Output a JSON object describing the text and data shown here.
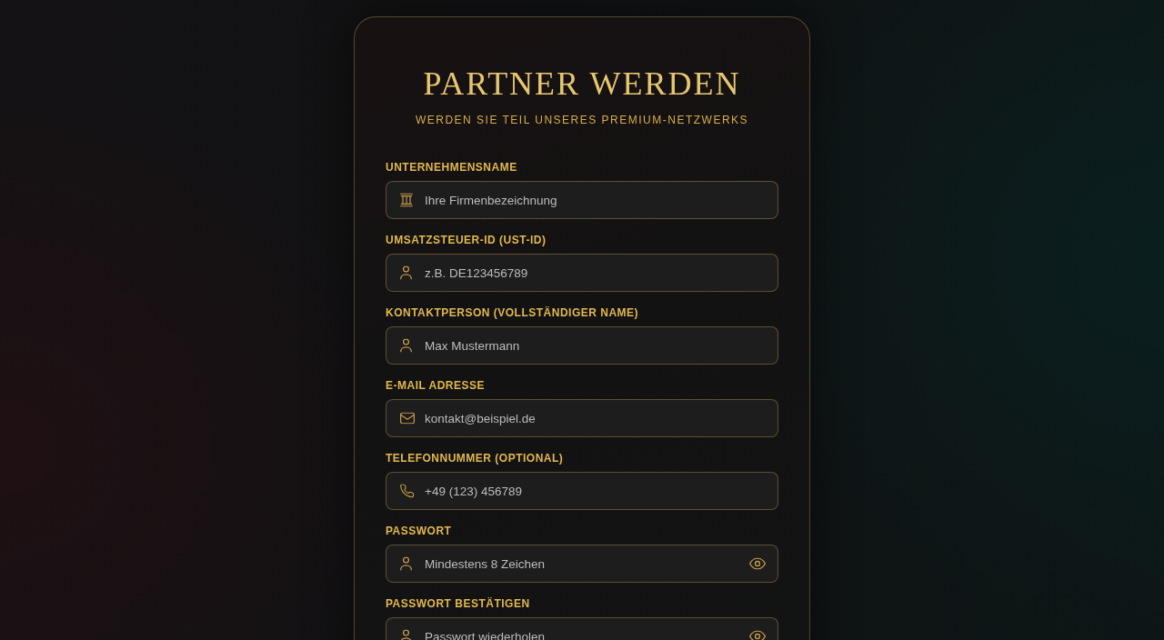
{
  "title": "PARTNER WERDEN",
  "subtitle": "WERDEN SIE TEIL UNSERES PREMIUM-NETZWERKS",
  "fields": [
    {
      "kind": "company",
      "label": "UNTERNEHMENSNAME",
      "placeholder": "Ihre Firmenbezeichnung"
    },
    {
      "kind": "text",
      "label": "UMSATZSTEUER-ID (UST-ID)",
      "placeholder": "z.B. DE123456789"
    },
    {
      "kind": "text",
      "label": "KONTAKTPERSON (VOLLSTÄNDIGER NAME)",
      "placeholder": "Max Mustermann"
    },
    {
      "kind": "email",
      "label": "E-MAIL ADRESSE",
      "placeholder": "kontakt@beispiel.de"
    },
    {
      "kind": "phone",
      "label": "TELEFONNUMMER (OPTIONAL)",
      "placeholder": "+49 (123) 456789"
    },
    {
      "kind": "password",
      "label": "PASSWORT",
      "placeholder": "Mindestens 8 Zeichen"
    },
    {
      "kind": "password",
      "label": "PASSWORT BESTÄTIGEN",
      "placeholder": "Passwort wiederholen"
    }
  ]
}
